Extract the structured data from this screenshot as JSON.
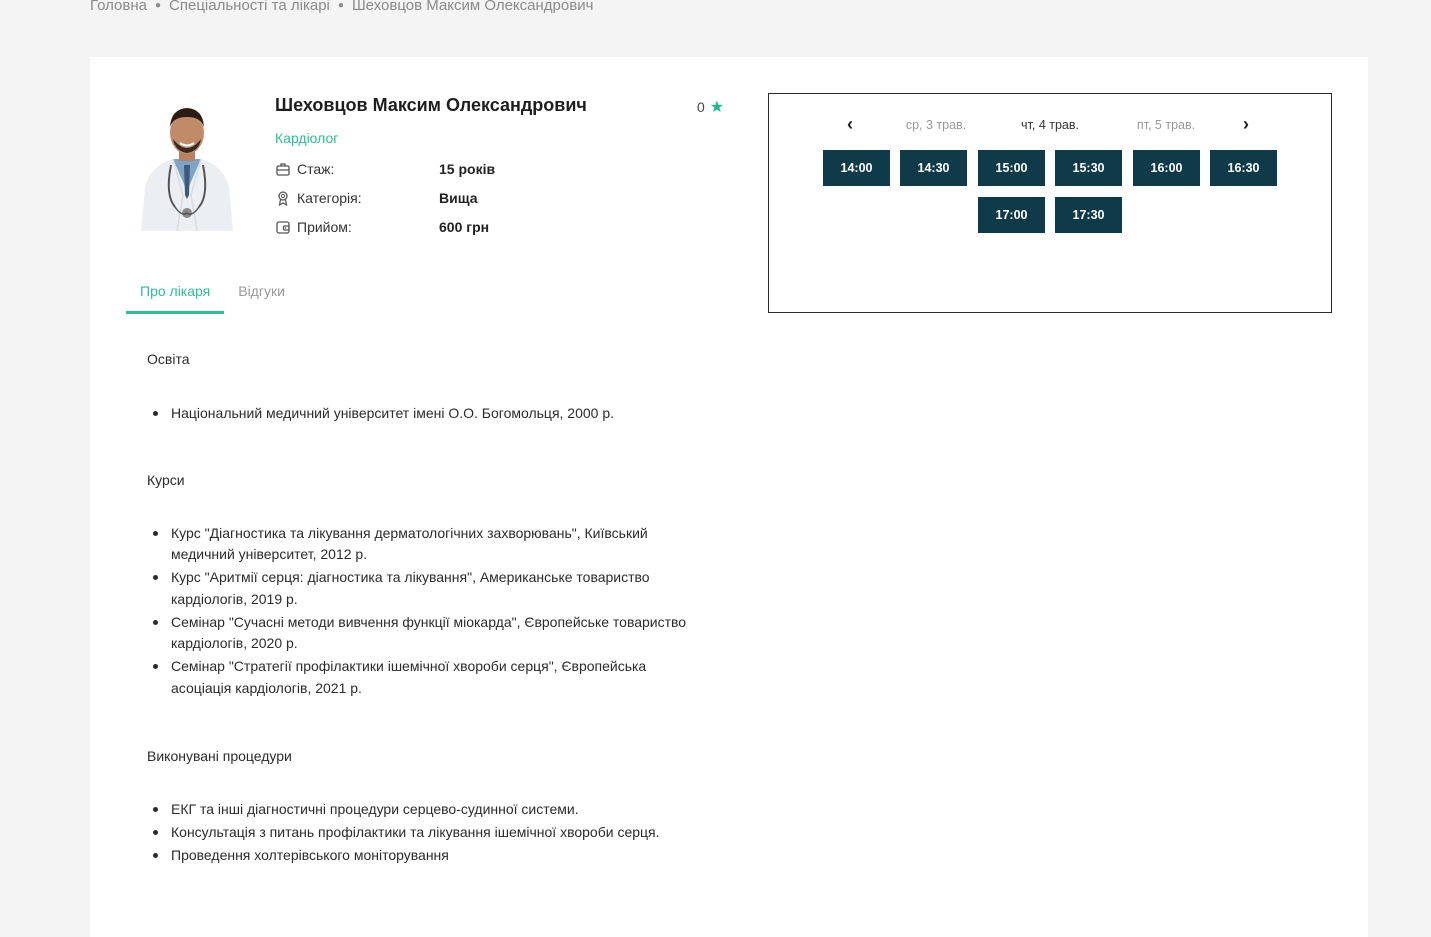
{
  "breadcrumb": {
    "items": [
      "Головна",
      "Спеціальності та лікарі",
      "Шеховцов Максим Олександрович"
    ]
  },
  "doctor": {
    "name": "Шеховцов Максим Олександрович",
    "specialty": "Кардіолог",
    "rating": "0",
    "info": [
      {
        "icon": "briefcase-icon",
        "label": "Стаж:",
        "value": "15 років"
      },
      {
        "icon": "award-icon",
        "label": "Категорія:",
        "value": "Вища"
      },
      {
        "icon": "wallet-icon",
        "label": "Прийом:",
        "value": "600 грн"
      }
    ]
  },
  "tabs": [
    {
      "label": "Про лікаря",
      "active": true
    },
    {
      "label": "Відгуки",
      "active": false
    }
  ],
  "about": {
    "education_title": "Освіта",
    "education": [
      "Національний медичний університет імені О.О. Богомольця, 2000 р."
    ],
    "courses_title": "Курси",
    "courses": [
      "Курс \"Діагностика та лікування дерматологічних захворювань\", Київський медичний університет, 2012 р.",
      "Курс \"Аритмії серця: діагностика та лікування\", Американське товариство кардіологів, 2019 р.",
      "Семінар \"Сучасні методи вивчення функції міокарда\", Європейське товариство кардіологів, 2020 р.",
      "Семінар \"Стратегії профілактики ішемічної хвороби серця\", Європейська асоціація кардіологів, 2021 р."
    ],
    "procedures_title": "Виконувані процедури",
    "procedures": [
      "ЕКГ та інші діагностичні процедури серцево-судинної системи.",
      "Консультація з питань профілактики та лікування ішемічної хвороби серця.",
      "Проведення холтерівського моніторування"
    ]
  },
  "schedule": {
    "prev_icon": "chevron-left-icon",
    "next_icon": "chevron-right-icon",
    "days": [
      {
        "label": "ср, 3 трав.",
        "active": false
      },
      {
        "label": "чт, 4 трав.",
        "active": true
      },
      {
        "label": "пт, 5 трав.",
        "active": false
      }
    ],
    "slots": [
      "14:00",
      "14:30",
      "15:00",
      "15:30",
      "16:00",
      "16:30",
      "17:00",
      "17:30"
    ]
  },
  "colors": {
    "accent": "#2fbd93",
    "slot_bg": "#0e3a4a"
  }
}
